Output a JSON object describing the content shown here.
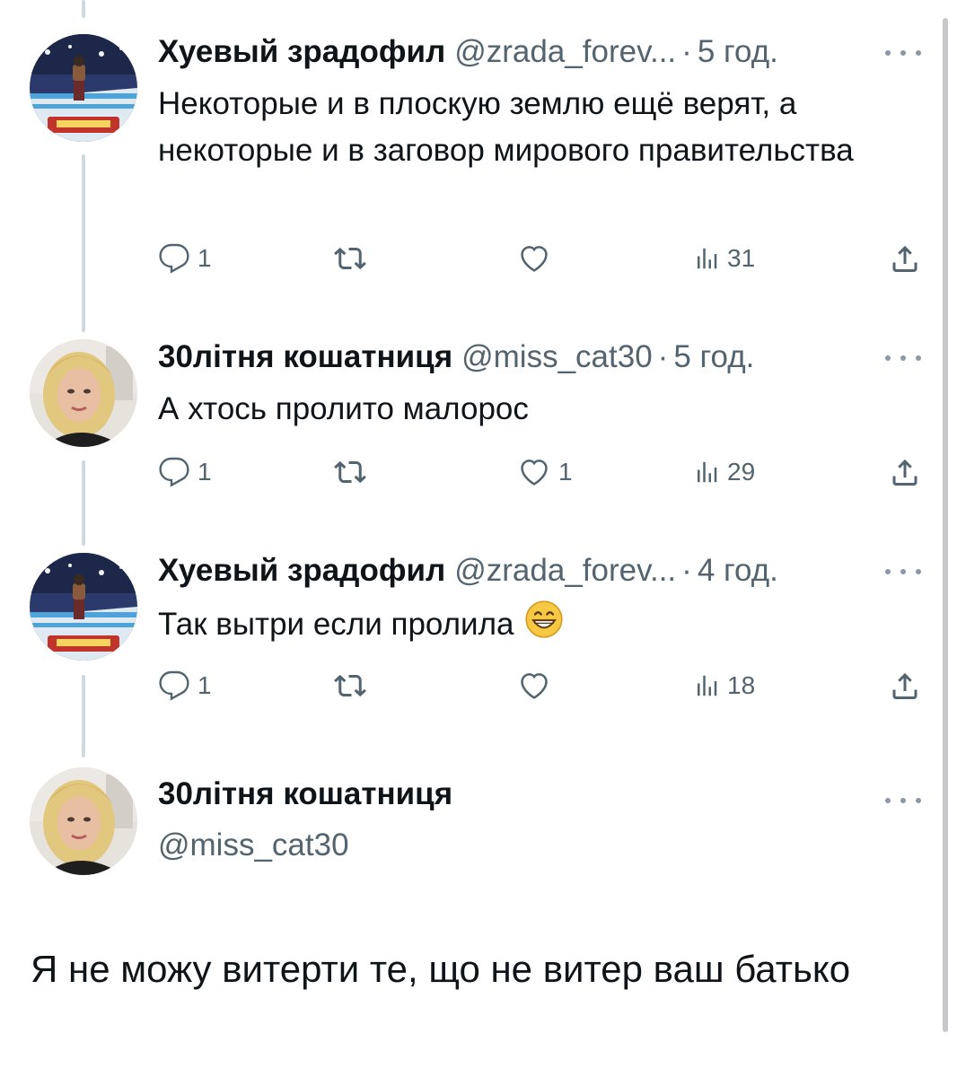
{
  "tweets": [
    {
      "author_name": "Хуевый зрадофил",
      "author_handle": "@zrada_forev...",
      "separator": "·",
      "time": "5 год.",
      "text": "Некоторые и в плоскую землю ещё верят, а некоторые и в заговор мирового правительства",
      "replies": "1",
      "retweets": "",
      "likes": "",
      "views": "31"
    },
    {
      "author_name": "30літня кошатниця",
      "author_handle": "@miss_cat30",
      "separator": "·",
      "time": "5 год.",
      "text": "А хтось пролито малорос",
      "replies": "1",
      "retweets": "",
      "likes": "1",
      "views": "29"
    },
    {
      "author_name": "Хуевый зрадофил",
      "author_handle": "@zrada_forev...",
      "separator": "·",
      "time": "4 год.",
      "text": "Так вытри если пролила",
      "replies": "1",
      "retweets": "",
      "likes": "",
      "views": "18"
    }
  ],
  "focal_tweet": {
    "author_name": "30літня кошатниця",
    "author_handle": "@miss_cat30",
    "text": "Я не можу витерти те, що не витер ваш батько"
  },
  "icons": {
    "reply": "reply-icon",
    "retweet": "retweet-icon",
    "like": "heart-icon",
    "views": "views-icon",
    "share": "share-icon",
    "more": "more-icon",
    "emoji": "grinning-emoji"
  },
  "colors": {
    "text": "#0f1419",
    "secondary": "#536471",
    "thread_line": "#cfd9de"
  }
}
